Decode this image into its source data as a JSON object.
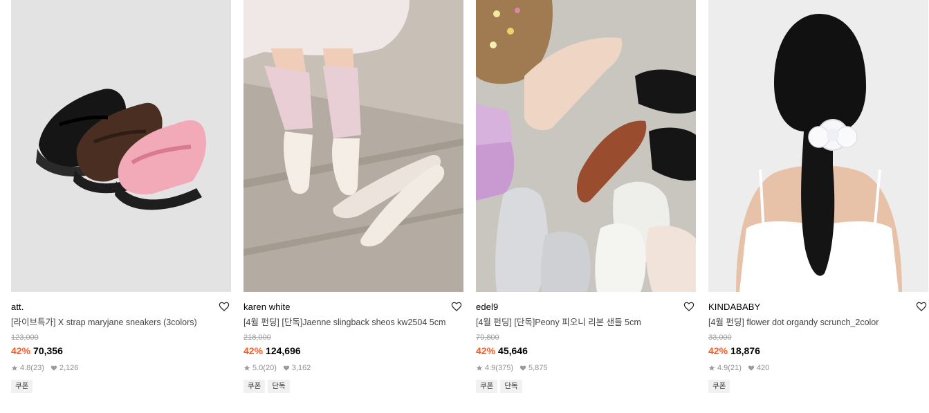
{
  "products": [
    {
      "brand": "att.",
      "title": "[라이브특가] X strap maryjane sneakers (3colors)",
      "original_price": "123,000",
      "discount": "42%",
      "price": "70,356",
      "rating": "4.8",
      "reviews": "(23)",
      "likes": "2,126",
      "tags": [
        "쿠폰"
      ]
    },
    {
      "brand": "karen white",
      "title": "[4월 펀딩] [단독]Jaenne slingback sheos kw2504 5cm",
      "original_price": "218,000",
      "discount": "42%",
      "price": "124,696",
      "rating": "5.0",
      "reviews": "(20)",
      "likes": "3,162",
      "tags": [
        "쿠폰",
        "단독"
      ]
    },
    {
      "brand": "edel9",
      "title": "[4월 펀딩] [단독]Peony 피오니 리본 샌들 5cm",
      "original_price": "79,800",
      "discount": "42%",
      "price": "45,646",
      "rating": "4.9",
      "reviews": "(375)",
      "likes": "5,875",
      "tags": [
        "쿠폰",
        "단독"
      ]
    },
    {
      "brand": "KINDABABY",
      "title": "[4월 펀딩] flower dot organdy scrunch_2color",
      "original_price": "33,000",
      "discount": "42%",
      "price": "18,876",
      "rating": "4.9",
      "reviews": "(21)",
      "likes": "420",
      "tags": [
        "쿠폰"
      ]
    }
  ],
  "colors": {
    "discount": "#ff5a1f",
    "muted": "#8f8f8f",
    "tag_bg": "#f1f1f1"
  }
}
